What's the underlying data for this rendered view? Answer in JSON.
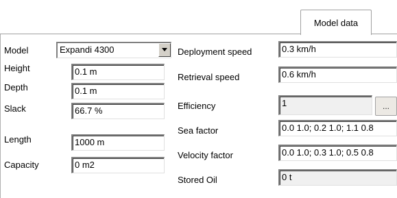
{
  "tabs": {
    "model_data": "Model data"
  },
  "left": {
    "model_label": "Model",
    "model_value": "Expandi 4300",
    "height_label": "Height",
    "height_value": "0.1 m",
    "depth_label": "Depth",
    "depth_value": "0.1 m",
    "slack_label": "Slack",
    "slack_value": "66.7 %",
    "length_label": "Length",
    "length_value": "1000 m",
    "capacity_label": "Capacity",
    "capacity_value": "0 m2"
  },
  "right": {
    "deployment_label": "Deployment speed",
    "deployment_value": "0.3 km/h",
    "retrieval_label": "Retrieval speed",
    "retrieval_value": "0.6 km/h",
    "efficiency_label": "Efficiency",
    "efficiency_value": "1",
    "efficiency_button": "...",
    "sea_factor_label": "Sea factor",
    "sea_factor_value": "0.0 1.0; 0.2 1.0; 1.1 0.8",
    "velocity_label": "Velocity factor",
    "velocity_value": "0.0 1.0; 0.3 1.0; 0.5 0.8",
    "stored_oil_label": "Stored Oil",
    "stored_oil_value": "0 t"
  },
  "icons": {
    "dropdown": "chevron-down-icon"
  }
}
